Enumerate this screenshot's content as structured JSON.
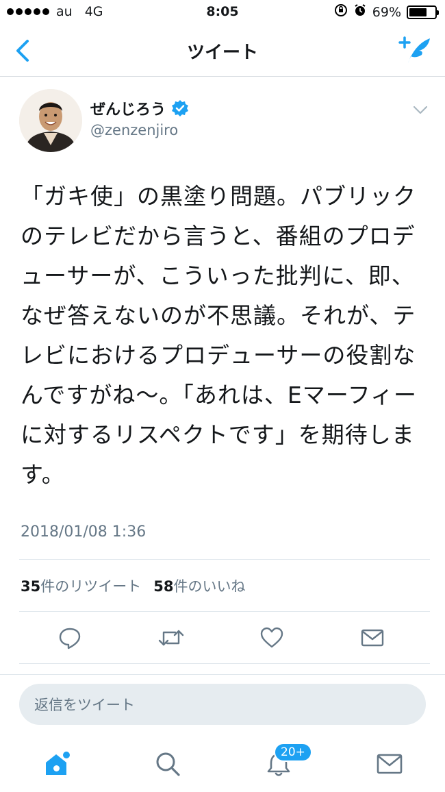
{
  "status_bar": {
    "carrier": "au",
    "network": "4G",
    "time": "8:05",
    "battery_text": "69%",
    "battery_level": 0.69
  },
  "nav": {
    "title": "ツイート",
    "back_icon": "chevron-left-icon",
    "compose_icon": "compose-tweet-icon"
  },
  "tweet": {
    "display_name": "ぜんじろう",
    "verified": true,
    "handle": "@zenzenjiro",
    "text": "「ガキ使」の黒塗り問題。パブリックのテレビだから言うと、番組のプロデューサーが、こういった批判に、即、なぜ答えないのが不思議。それが、テレビにおけるプロデューサーの役割なんですがね〜。「あれは、Eマーフィーに対するリスペクトです」を期待します。",
    "timestamp": "2018/01/08 1:36",
    "retweets_count": "35",
    "retweets_label": "件のリツイート",
    "likes_count": "58",
    "likes_label": "件のいいね"
  },
  "actions": [
    "reply-icon",
    "retweet-icon",
    "like-icon",
    "share-icon"
  ],
  "reply_box": {
    "placeholder": "返信をツイート"
  },
  "tabbar": {
    "notifications_badge": "20+"
  },
  "colors": {
    "accent": "#1da1f2",
    "text": "#14171a",
    "muted": "#657786",
    "divider": "#e1e8ed"
  }
}
